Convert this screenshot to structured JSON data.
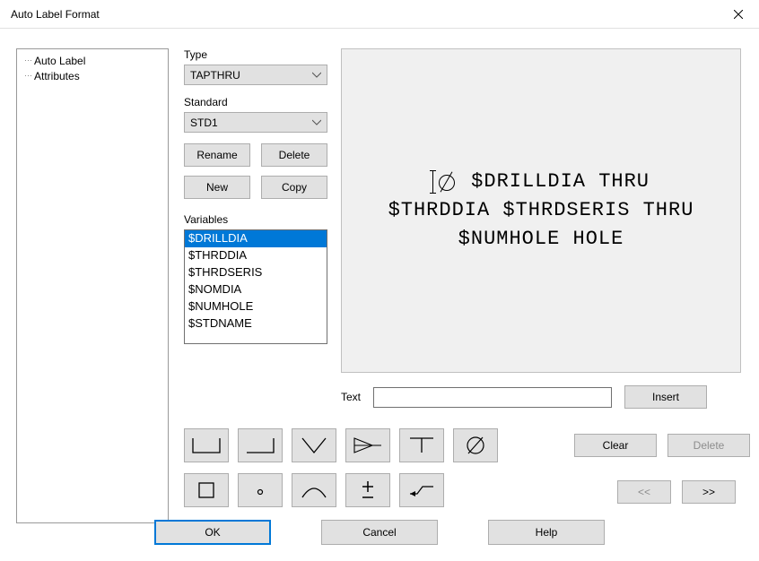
{
  "window": {
    "title": "Auto Label Format"
  },
  "tree": {
    "items": [
      "Auto Label",
      "Attributes"
    ]
  },
  "type": {
    "label": "Type",
    "value": "TAPTHRU"
  },
  "standard": {
    "label": "Standard",
    "value": "STD1"
  },
  "buttons": {
    "rename": "Rename",
    "delete": "Delete",
    "new": "New",
    "copy": "Copy",
    "insert": "Insert",
    "clear": "Clear",
    "delete2": "Delete",
    "prev": "<<",
    "next": ">>",
    "ok": "OK",
    "cancel": "Cancel",
    "help": "Help"
  },
  "variables": {
    "label": "Variables",
    "items": [
      "$DRILLDIA",
      "$THRDDIA",
      "$THRDSERIS",
      "$NOMDIA",
      "$NUMHOLE",
      "$STDNAME"
    ],
    "selected": 0
  },
  "preview": {
    "line1_after": " $DRILLDIA THRU",
    "line2": "$THRDDIA $THRDSERIS THRU",
    "line3": "$NUMHOLE HOLE"
  },
  "text": {
    "label": "Text",
    "value": ""
  },
  "symbols": {
    "row1": [
      "counterbore",
      "countersink",
      "depth-v",
      "depth-arrow",
      "spotface",
      "diameter"
    ],
    "row2": [
      "square",
      "radius-target",
      "arc",
      "plus-minus",
      "leader-arrow"
    ]
  }
}
